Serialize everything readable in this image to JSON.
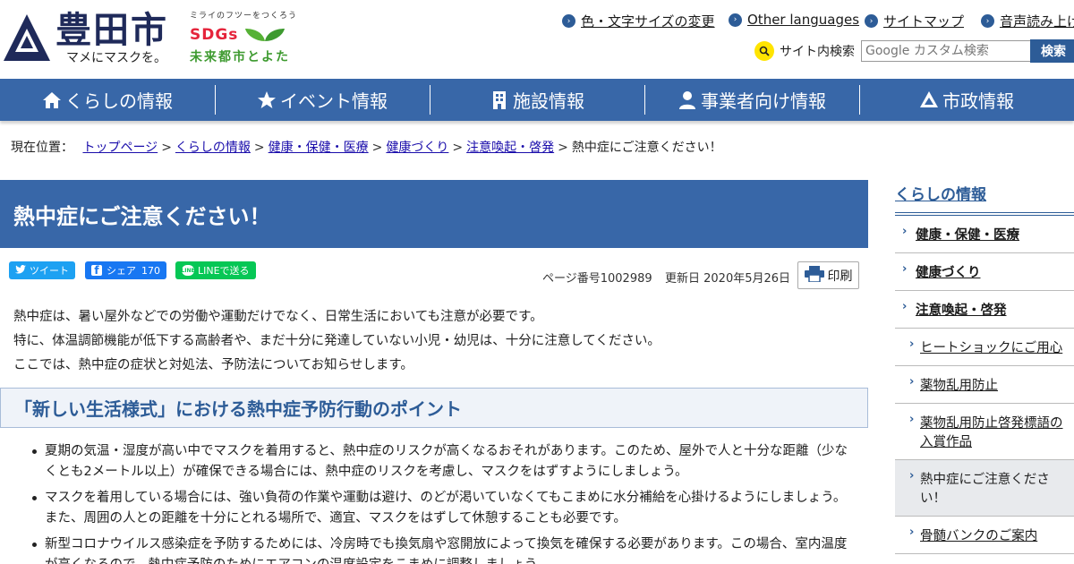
{
  "header": {
    "city_name": "豊田市",
    "slogan": "マメにマスクを。",
    "sdgs_tagline": "ミライのフツーをつくろう",
    "sdgs_word": "SDGs",
    "sdgs_future": "未来都市とよた",
    "links": [
      {
        "label": "色・文字サイズの変更"
      },
      {
        "label": "Other languages"
      },
      {
        "label": "サイトマップ"
      },
      {
        "label": "音声読み上げ"
      }
    ],
    "search": {
      "label": "サイト内検索",
      "placeholder": "Google カスタム検索",
      "button": "検索"
    }
  },
  "nav": [
    {
      "label": "くらしの情報",
      "icon": "home-icon"
    },
    {
      "label": "イベント情報",
      "icon": "star-icon"
    },
    {
      "label": "施設情報",
      "icon": "building-icon"
    },
    {
      "label": "事業者向け情報",
      "icon": "person-icon"
    },
    {
      "label": "市政情報",
      "icon": "emblem-icon"
    }
  ],
  "breadcrumb": {
    "prefix": "現在位置：",
    "items": [
      "トップページ",
      "くらしの情報",
      "健康・保健・医療",
      "健康づくり",
      "注意喚起・啓発"
    ],
    "current": "熱中症にご注意ください！"
  },
  "page": {
    "title": "熱中症にご注意ください！",
    "share": {
      "tweet": "ツイート",
      "fb_share": "シェア",
      "fb_count": "170",
      "line": "LINEで送る"
    },
    "page_number": "ページ番号1002989",
    "updated": "更新日 2020年5月26日",
    "print": "印刷",
    "intro": [
      "熱中症は、暑い屋外などでの労働や運動だけでなく、日常生活においても注意が必要です。",
      "特に、体温調節機能が低下する高齢者や、まだ十分に発達していない小児・幼児は、十分に注意してください。",
      "ここでは、熱中症の症状と対処法、予防法についてお知らせします。"
    ],
    "section_heading": "「新しい生活様式」における熱中症予防行動のポイント",
    "bullets": [
      "夏期の気温・湿度が高い中でマスクを着用すると、熱中症のリスクが高くなるおそれがあります。このため、屋外で人と十分な距離（少なくとも2メートル以上）が確保できる場合には、熱中症のリスクを考慮し、マスクをはずすようにしましょう。",
      "マスクを着用している場合には、強い負荷の作業や運動は避け、のどが渇いていなくてもこまめに水分補給を心掛けるようにしましょう。また、周囲の人との距離を十分にとれる場所で、適宜、マスクをはずして休憩することも必要です。",
      "新型コロナウイルス感染症を予防するためには、冷房時でも換気扇や窓開放によって換気を確保する必要があります。この場合、室内温度が高くなるので、熱中症予防のためにエアコンの温度設定をこまめに調整しましょう。"
    ]
  },
  "sidebar": {
    "title": "くらしの情報",
    "items": [
      {
        "label": "健康・保健・医療"
      },
      {
        "label": "健康づくり"
      },
      {
        "label": "注意喚起・啓発"
      },
      {
        "label": "ヒートショックにご用心"
      },
      {
        "label": "薬物乱用防止"
      },
      {
        "label": "薬物乱用防止啓発標語の入賞作品"
      },
      {
        "label": "熱中症にご注意ください！"
      },
      {
        "label": "骨髄バンクのご案内"
      }
    ]
  },
  "colors": {
    "brand_blue": "#3867a8",
    "link_blue": "#1a0dab",
    "sdgs_green": "#3d9a2f",
    "twitter": "#1da1f2",
    "facebook": "#1877f2",
    "line": "#06c755"
  }
}
